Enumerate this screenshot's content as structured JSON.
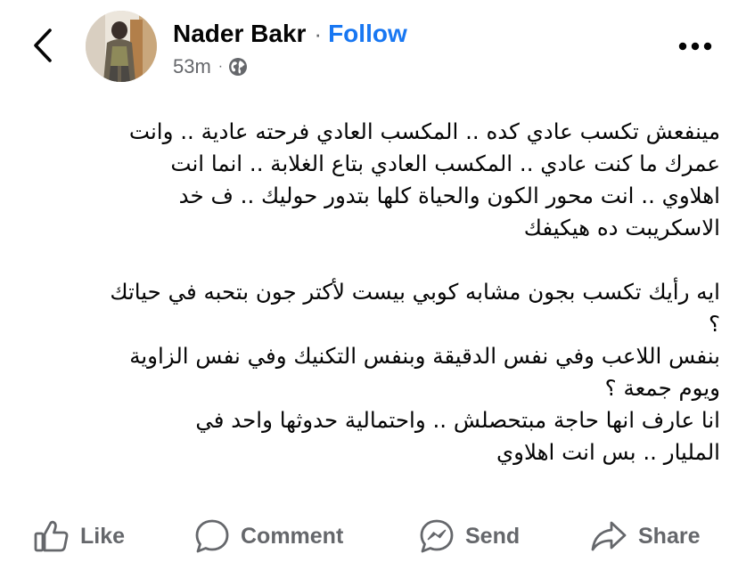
{
  "header": {
    "author_name": "Nader Bakr",
    "separator": "·",
    "follow_label": "Follow",
    "timestamp": "53m",
    "meta_separator": "·",
    "privacy_icon": "globe-icon",
    "back_icon": "chevron-left-icon",
    "more_icon": "more-horizontal-icon"
  },
  "post": {
    "lines": [
      "مينفعش تكسب عادي كده .. المكسب العادي فرحته عادية .. وانت",
      "عمرك ما كنت عادي .. المكسب العادي بتاع الغلابة .. انما انت",
      "اهلاوي .. انت محور الكون والحياة كلها بتدور حوليك .. ف خد",
      "الاسكريبت ده هيكيفك",
      "",
      "ايه رأيك تكسب بجون مشابه كوبي بيست لأكتر جون بتحبه في حياتك",
      "؟",
      "بنفس اللاعب وفي نفس الدقيقة وبنفس التكنيك وفي نفس الزاوية",
      "ويوم جمعة ؟",
      "انا عارف انها حاجة مبتحصلش .. واحتمالية حدوثها واحد في",
      "المليار .. بس انت اهلاوي"
    ]
  },
  "actions": {
    "like": {
      "label": "Like",
      "icon": "thumbs-up-icon"
    },
    "comment": {
      "label": "Comment",
      "icon": "comment-bubble-icon"
    },
    "send": {
      "label": "Send",
      "icon": "messenger-icon"
    },
    "share": {
      "label": "Share",
      "icon": "share-arrow-icon"
    }
  },
  "colors": {
    "text": "#050505",
    "secondary": "#65676b",
    "accent": "#1877f2",
    "background": "#ffffff"
  }
}
